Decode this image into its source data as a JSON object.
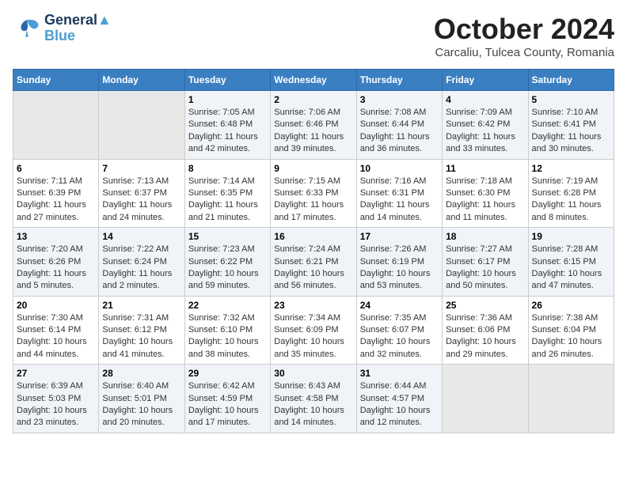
{
  "logo": {
    "line1": "General",
    "line2": "Blue"
  },
  "title": "October 2024",
  "location": "Carcaliu, Tulcea County, Romania",
  "days_of_week": [
    "Sunday",
    "Monday",
    "Tuesday",
    "Wednesday",
    "Thursday",
    "Friday",
    "Saturday"
  ],
  "weeks": [
    [
      {
        "day": "",
        "info": ""
      },
      {
        "day": "",
        "info": ""
      },
      {
        "day": "1",
        "info": "Sunrise: 7:05 AM\nSunset: 6:48 PM\nDaylight: 11 hours and 42 minutes."
      },
      {
        "day": "2",
        "info": "Sunrise: 7:06 AM\nSunset: 6:46 PM\nDaylight: 11 hours and 39 minutes."
      },
      {
        "day": "3",
        "info": "Sunrise: 7:08 AM\nSunset: 6:44 PM\nDaylight: 11 hours and 36 minutes."
      },
      {
        "day": "4",
        "info": "Sunrise: 7:09 AM\nSunset: 6:42 PM\nDaylight: 11 hours and 33 minutes."
      },
      {
        "day": "5",
        "info": "Sunrise: 7:10 AM\nSunset: 6:41 PM\nDaylight: 11 hours and 30 minutes."
      }
    ],
    [
      {
        "day": "6",
        "info": "Sunrise: 7:11 AM\nSunset: 6:39 PM\nDaylight: 11 hours and 27 minutes."
      },
      {
        "day": "7",
        "info": "Sunrise: 7:13 AM\nSunset: 6:37 PM\nDaylight: 11 hours and 24 minutes."
      },
      {
        "day": "8",
        "info": "Sunrise: 7:14 AM\nSunset: 6:35 PM\nDaylight: 11 hours and 21 minutes."
      },
      {
        "day": "9",
        "info": "Sunrise: 7:15 AM\nSunset: 6:33 PM\nDaylight: 11 hours and 17 minutes."
      },
      {
        "day": "10",
        "info": "Sunrise: 7:16 AM\nSunset: 6:31 PM\nDaylight: 11 hours and 14 minutes."
      },
      {
        "day": "11",
        "info": "Sunrise: 7:18 AM\nSunset: 6:30 PM\nDaylight: 11 hours and 11 minutes."
      },
      {
        "day": "12",
        "info": "Sunrise: 7:19 AM\nSunset: 6:28 PM\nDaylight: 11 hours and 8 minutes."
      }
    ],
    [
      {
        "day": "13",
        "info": "Sunrise: 7:20 AM\nSunset: 6:26 PM\nDaylight: 11 hours and 5 minutes."
      },
      {
        "day": "14",
        "info": "Sunrise: 7:22 AM\nSunset: 6:24 PM\nDaylight: 11 hours and 2 minutes."
      },
      {
        "day": "15",
        "info": "Sunrise: 7:23 AM\nSunset: 6:22 PM\nDaylight: 10 hours and 59 minutes."
      },
      {
        "day": "16",
        "info": "Sunrise: 7:24 AM\nSunset: 6:21 PM\nDaylight: 10 hours and 56 minutes."
      },
      {
        "day": "17",
        "info": "Sunrise: 7:26 AM\nSunset: 6:19 PM\nDaylight: 10 hours and 53 minutes."
      },
      {
        "day": "18",
        "info": "Sunrise: 7:27 AM\nSunset: 6:17 PM\nDaylight: 10 hours and 50 minutes."
      },
      {
        "day": "19",
        "info": "Sunrise: 7:28 AM\nSunset: 6:15 PM\nDaylight: 10 hours and 47 minutes."
      }
    ],
    [
      {
        "day": "20",
        "info": "Sunrise: 7:30 AM\nSunset: 6:14 PM\nDaylight: 10 hours and 44 minutes."
      },
      {
        "day": "21",
        "info": "Sunrise: 7:31 AM\nSunset: 6:12 PM\nDaylight: 10 hours and 41 minutes."
      },
      {
        "day": "22",
        "info": "Sunrise: 7:32 AM\nSunset: 6:10 PM\nDaylight: 10 hours and 38 minutes."
      },
      {
        "day": "23",
        "info": "Sunrise: 7:34 AM\nSunset: 6:09 PM\nDaylight: 10 hours and 35 minutes."
      },
      {
        "day": "24",
        "info": "Sunrise: 7:35 AM\nSunset: 6:07 PM\nDaylight: 10 hours and 32 minutes."
      },
      {
        "day": "25",
        "info": "Sunrise: 7:36 AM\nSunset: 6:06 PM\nDaylight: 10 hours and 29 minutes."
      },
      {
        "day": "26",
        "info": "Sunrise: 7:38 AM\nSunset: 6:04 PM\nDaylight: 10 hours and 26 minutes."
      }
    ],
    [
      {
        "day": "27",
        "info": "Sunrise: 6:39 AM\nSunset: 5:03 PM\nDaylight: 10 hours and 23 minutes."
      },
      {
        "day": "28",
        "info": "Sunrise: 6:40 AM\nSunset: 5:01 PM\nDaylight: 10 hours and 20 minutes."
      },
      {
        "day": "29",
        "info": "Sunrise: 6:42 AM\nSunset: 4:59 PM\nDaylight: 10 hours and 17 minutes."
      },
      {
        "day": "30",
        "info": "Sunrise: 6:43 AM\nSunset: 4:58 PM\nDaylight: 10 hours and 14 minutes."
      },
      {
        "day": "31",
        "info": "Sunrise: 6:44 AM\nSunset: 4:57 PM\nDaylight: 10 hours and 12 minutes."
      },
      {
        "day": "",
        "info": ""
      },
      {
        "day": "",
        "info": ""
      }
    ]
  ]
}
